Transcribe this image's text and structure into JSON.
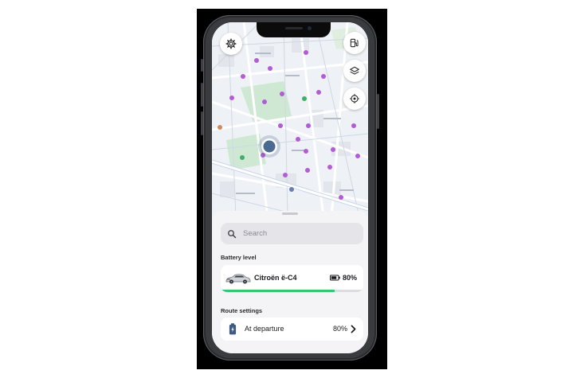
{
  "search": {
    "placeholder": "Search"
  },
  "battery_section": {
    "label": "Battery level",
    "vehicle": {
      "name": "Citroën ë-C4",
      "battery": "80%",
      "battery_fraction": 0.8
    }
  },
  "route_section": {
    "label": "Route settings",
    "items": [
      {
        "label": "At departure",
        "value": "80%"
      }
    ]
  },
  "icons": {
    "settings": "gear-icon",
    "station": "charging-station-icon",
    "layers": "layers-icon",
    "locate": "crosshair-icon",
    "search": "search-icon",
    "battery": "battery-icon",
    "plug": "battery-charge-icon",
    "chevron": "chevron-right-icon",
    "car": "car-icon"
  },
  "colors": {
    "accent_green": "#33c773",
    "poi_purple": "#b35bd6",
    "location_blue": "#3d5a80",
    "park_green": "#cfe8d3"
  }
}
